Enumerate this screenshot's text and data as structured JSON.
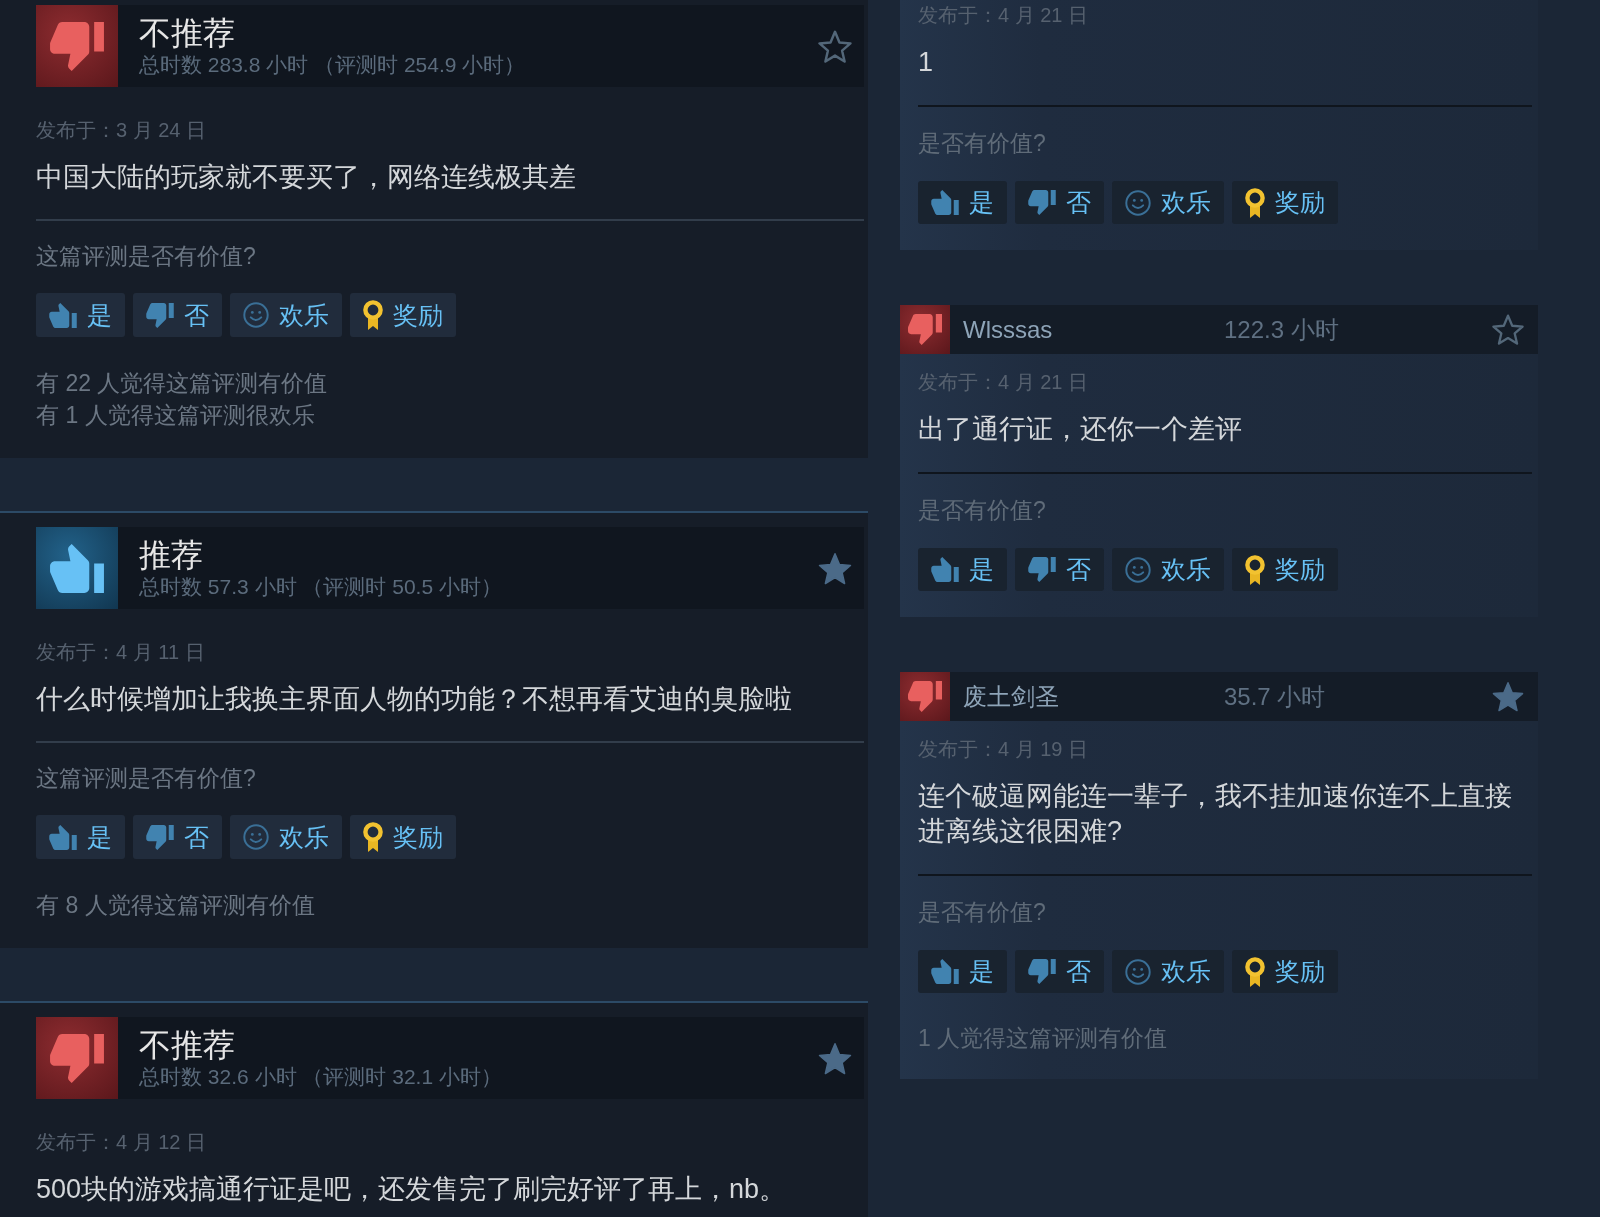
{
  "left_reviews": [
    {
      "recommended": false,
      "verdict": "不推荐",
      "hours": "总时数 283.8 小时 （评测时 254.9 小时）",
      "starred": false,
      "date": "发布于：3 月 24 日",
      "text": "中国大陆的玩家就不要买了，网络连线极其差",
      "question": "这篇评测是否有价值?",
      "buttons": [
        {
          "kind": "yes",
          "label": "是"
        },
        {
          "kind": "no",
          "label": "否"
        },
        {
          "kind": "funny",
          "label": "欢乐"
        },
        {
          "kind": "award",
          "label": "奖励"
        }
      ],
      "helpful": [
        "有 22 人觉得这篇评测有价值",
        "有 1 人觉得这篇评测很欢乐"
      ]
    },
    {
      "recommended": true,
      "verdict": "推荐",
      "hours": "总时数 57.3 小时 （评测时 50.5 小时）",
      "starred": true,
      "date": "发布于：4 月 11 日",
      "text": "什么时候增加让我换主界面人物的功能？不想再看艾迪的臭脸啦",
      "question": "这篇评测是否有价值?",
      "buttons": [
        {
          "kind": "yes",
          "label": "是"
        },
        {
          "kind": "no",
          "label": "否"
        },
        {
          "kind": "funny",
          "label": "欢乐"
        },
        {
          "kind": "award",
          "label": "奖励"
        }
      ],
      "helpful": [
        "有 8 人觉得这篇评测有价值"
      ]
    },
    {
      "recommended": false,
      "verdict": "不推荐",
      "hours": "总时数 32.6 小时 （评测时 32.1 小时）",
      "starred": true,
      "date": "发布于：4 月 12 日",
      "text": "500块的游戏搞通行证是吧，还发售完了刷完好评了再上，nb。"
    }
  ],
  "right_reviews": [
    {
      "date": "发布于：4 月 21 日",
      "text": "1",
      "question": "是否有价值?",
      "buttons": [
        {
          "kind": "yes",
          "label": "是"
        },
        {
          "kind": "no",
          "label": "否"
        },
        {
          "kind": "funny",
          "label": "欢乐"
        },
        {
          "kind": "award",
          "label": "奖励"
        }
      ]
    },
    {
      "recommended": false,
      "author": "Wlsssas",
      "hours": "122.3 小时",
      "starred": false,
      "date": "发布于：4 月 21 日",
      "text": "出了通行证，还你一个差评",
      "question": "是否有价值?",
      "buttons": [
        {
          "kind": "yes",
          "label": "是"
        },
        {
          "kind": "no",
          "label": "否"
        },
        {
          "kind": "funny",
          "label": "欢乐"
        },
        {
          "kind": "award",
          "label": "奖励"
        }
      ]
    },
    {
      "recommended": false,
      "author": "废土剑圣",
      "hours": "35.7 小时",
      "starred": true,
      "date": "发布于：4 月 19 日",
      "text": "连个破逼网能连一辈子，我不挂加速你连不上直接进离线这很困难?",
      "question": "是否有价值?",
      "buttons": [
        {
          "kind": "yes",
          "label": "是"
        },
        {
          "kind": "no",
          "label": "否"
        },
        {
          "kind": "funny",
          "label": "欢乐"
        },
        {
          "kind": "award",
          "label": "奖励"
        }
      ],
      "helpful": [
        "1 人觉得这篇评测有价值"
      ]
    }
  ]
}
